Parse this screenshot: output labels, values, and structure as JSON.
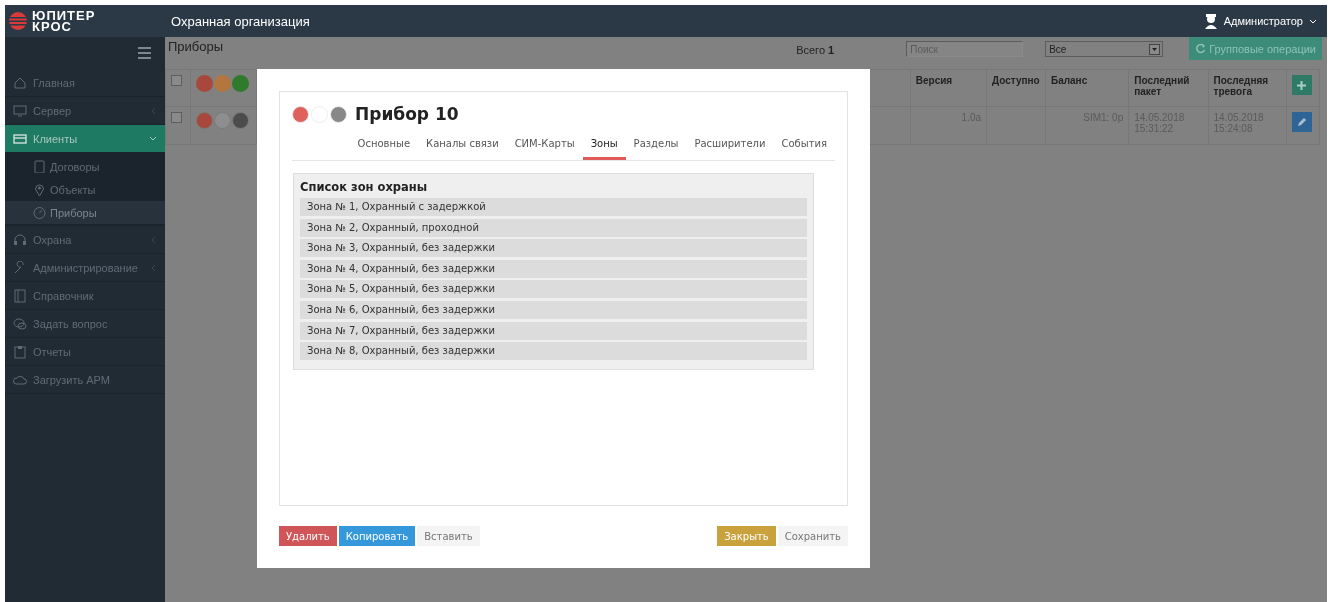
{
  "topbar": {
    "logo_line1": "ЮПИТЕР",
    "logo_line2": "КРОС",
    "title": "Охранная организация",
    "user": "Администратор"
  },
  "sidebar": {
    "items": [
      {
        "label": "Главная",
        "kind": "link",
        "selected": false
      },
      {
        "label": "Сервер",
        "kind": "group",
        "selected": false,
        "expanded": false
      },
      {
        "label": "Клиенты",
        "kind": "group",
        "selected": true,
        "expanded": true,
        "children": [
          {
            "label": "Договоры",
            "selected": false
          },
          {
            "label": "Объекты",
            "selected": false
          },
          {
            "label": "Приборы",
            "selected": true
          }
        ]
      },
      {
        "label": "Охрана",
        "kind": "group",
        "selected": false,
        "expanded": false
      },
      {
        "label": "Администрирование",
        "kind": "group",
        "selected": false,
        "expanded": false
      },
      {
        "label": "Справочник",
        "kind": "link",
        "selected": false
      },
      {
        "label": "Задать вопрос",
        "kind": "link",
        "selected": false
      },
      {
        "label": "Отчеты",
        "kind": "link",
        "selected": false
      },
      {
        "label": "Загрузить АРМ",
        "kind": "link",
        "selected": false
      }
    ]
  },
  "toolbar": {
    "title": "Приборы",
    "total_label": "Всего",
    "total_value": "1",
    "search": {
      "placeholder": "Поиск"
    },
    "filter": {
      "value": "Все"
    },
    "group_button": "Групповые операции"
  },
  "table": {
    "header": {
      "checked": false,
      "dots": [
        {
          "color": "#a8473c"
        },
        {
          "color": "#b3763e"
        },
        {
          "color": "#2f7a2c"
        }
      ]
    },
    "columns": [
      "Версия",
      "Доступно",
      "Баланс",
      "Последний пакет",
      "Последняя тревога"
    ],
    "rows": [
      {
        "checked": false,
        "dots": [
          {
            "color": "#a8473c"
          },
          {
            "color": "#8e8e8e"
          },
          {
            "color": "#4c4c4c"
          }
        ],
        "version": "1.0a",
        "balance": "SIM1: 0р",
        "last_packet": "14.05.2018 15:31:22",
        "last_alarm": "14.05.2018 15:24:08"
      }
    ]
  },
  "modal": {
    "dots": [
      {
        "color": "#e0605c"
      },
      {
        "color": "#ffffff"
      },
      {
        "color": "#888888"
      }
    ],
    "title": "Прибор 10",
    "tabs": [
      {
        "label": "Основные",
        "selected": false
      },
      {
        "label": "Каналы связи",
        "selected": false
      },
      {
        "label": "СИМ-Карты",
        "selected": false
      },
      {
        "label": "Зоны",
        "selected": true
      },
      {
        "label": "Разделы",
        "selected": false
      },
      {
        "label": "Расширители",
        "selected": false
      },
      {
        "label": "События",
        "selected": false
      }
    ],
    "zones_title": "Список зон охраны",
    "zones": [
      "Зона № 1, Охранный с задержкой",
      "Зона № 2, Охранный, проходной",
      "Зона № 3, Охранный, без задержки",
      "Зона № 4, Охранный, без задержки",
      "Зона № 5, Охранный, без задержки",
      "Зона № 6, Охранный, без задержки",
      "Зона № 7, Охранный, без задержки",
      "Зона № 8, Охранный, без задержки"
    ],
    "buttons_left": [
      {
        "label": "Удалить",
        "kind": "danger"
      },
      {
        "label": "Копировать",
        "kind": "primary"
      },
      {
        "label": "Вставить",
        "kind": "default"
      }
    ],
    "buttons_right": [
      {
        "label": "Закрыть",
        "kind": "warning"
      },
      {
        "label": "Сохранить",
        "kind": "default"
      }
    ]
  }
}
